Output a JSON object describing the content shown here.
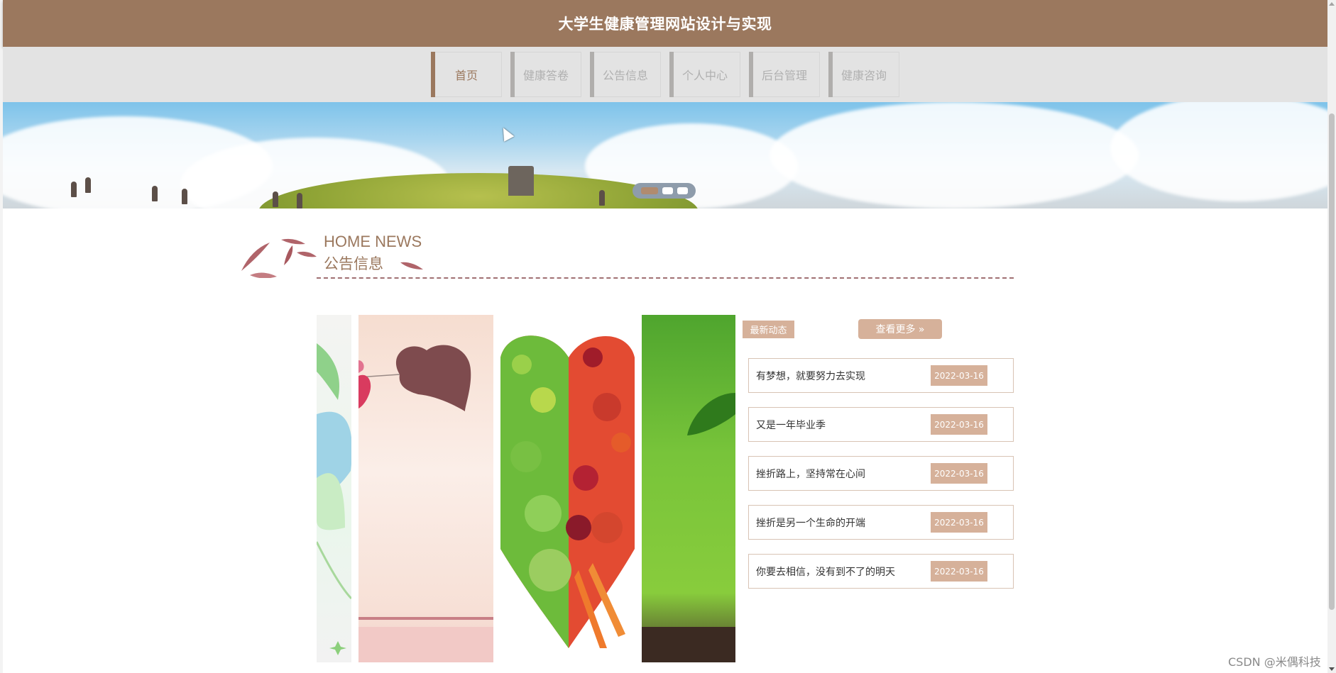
{
  "site": {
    "title": "大学生健康管理网站设计与实现"
  },
  "nav": {
    "items": [
      {
        "label": "首页",
        "active": true
      },
      {
        "label": "健康答卷",
        "active": false
      },
      {
        "label": "公告信息",
        "active": false
      },
      {
        "label": "个人中心",
        "active": false
      },
      {
        "label": "后台管理",
        "active": false
      },
      {
        "label": "健康咨询",
        "active": false
      }
    ]
  },
  "banner": {
    "slide_count": 3,
    "active_slide": 1
  },
  "section": {
    "title_en": "HOME NEWS",
    "title_cn": "公告信息"
  },
  "news": {
    "badge": "最新动态",
    "more_label": "查看更多 »",
    "items": [
      {
        "title": "有梦想，就要努力去实现",
        "date": "2022-03-16"
      },
      {
        "title": "又是一年毕业季",
        "date": "2022-03-16"
      },
      {
        "title": "挫折路上，坚持常在心间",
        "date": "2022-03-16"
      },
      {
        "title": "挫折是另一个生命的开端",
        "date": "2022-03-16"
      },
      {
        "title": "你要去相信，没有到不了的明天",
        "date": "2022-03-16"
      }
    ]
  },
  "watermark": "CSDN @米偶科技",
  "colors": {
    "brand": "#9b785e",
    "accent": "#d6b19a",
    "nav_bg": "#e3e3e3",
    "divider": "#a06f72"
  }
}
